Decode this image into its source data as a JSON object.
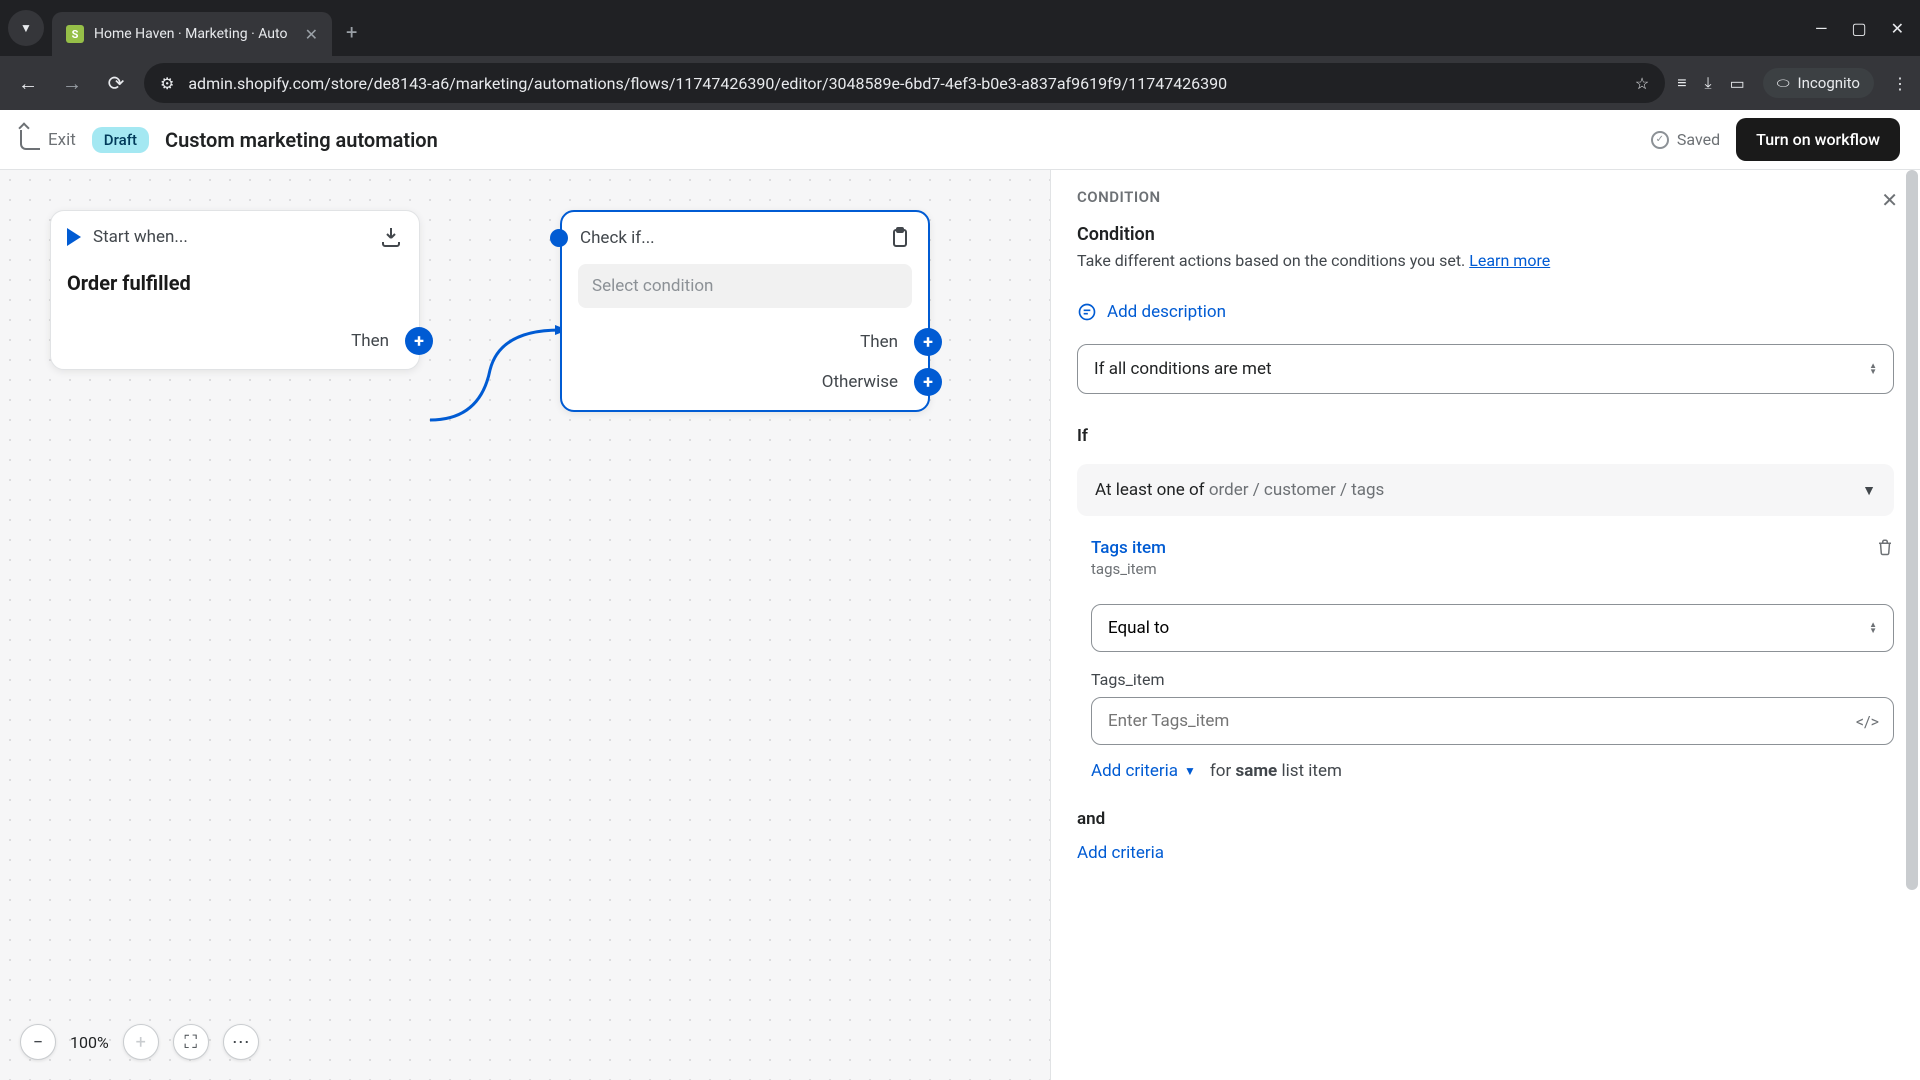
{
  "browser": {
    "tabTitle": "Home Haven · Marketing · Auto",
    "url": "admin.shopify.com/store/de8143-a6/marketing/automations/flows/11747426390/editor/3048589e-6bd7-4ef3-b0e3-a837af9619f9/11747426390",
    "incognito": "Incognito"
  },
  "header": {
    "exit": "Exit",
    "draft": "Draft",
    "title": "Custom marketing automation",
    "saved": "Saved",
    "turnOn": "Turn on workflow"
  },
  "canvas": {
    "start": {
      "title": "Start when...",
      "trigger": "Order fulfilled",
      "then": "Then"
    },
    "condition": {
      "title": "Check if...",
      "placeholder": "Select condition",
      "then": "Then",
      "otherwise": "Otherwise"
    },
    "zoom": "100%"
  },
  "panel": {
    "label": "CONDITION",
    "title": "Condition",
    "desc": "Take different actions based on the conditions you set. ",
    "learnMore": "Learn more",
    "addDesc": "Add description",
    "matchMode": "If all conditions are met",
    "ifLabel": "If",
    "groupPrefix": "At least one of ",
    "groupPath": "order / customer / tags",
    "criteria": {
      "title": "Tags item",
      "sub": "tags_item",
      "operator": "Equal to",
      "fieldLabel": "Tags_item",
      "placeholder": "Enter Tags_item"
    },
    "addCriteria": "Add criteria",
    "forSame1": "for ",
    "forSameBold": "same",
    "forSame2": " list item",
    "andLabel": "and",
    "addCriteriaBottom": "Add criteria"
  }
}
